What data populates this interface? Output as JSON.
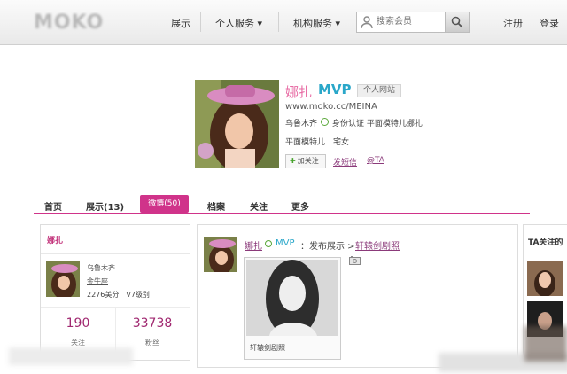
{
  "brand": {
    "logo_text": "MOKO"
  },
  "nav": {
    "items": [
      {
        "label": "展示"
      },
      {
        "label": "个人服务 ▾"
      },
      {
        "label": "机构服务 ▾"
      }
    ],
    "search_placeholder": "搜索会员",
    "register": "注册",
    "login": "登录"
  },
  "profile": {
    "name": "娜扎",
    "badge": "MVP",
    "site_button": "个人网站",
    "url": "www.moko.cc/MEINA",
    "city": "乌鲁木齐",
    "verification": "身份认证 平面模特儿娜扎",
    "tags": "平面模特儿　宅女",
    "follow_button": "加关注",
    "message_link": "发短信",
    "at_link": "@TA"
  },
  "tabs": [
    {
      "label": "首页"
    },
    {
      "label": "展示(13)"
    },
    {
      "label": "微博(50)"
    },
    {
      "label": "档案"
    },
    {
      "label": "关注"
    },
    {
      "label": "更多"
    }
  ],
  "left_card": {
    "title": "娜扎",
    "city": "乌鲁木齐",
    "link": "金牛座",
    "score": "2276美分　V7级别",
    "stats": [
      {
        "value": "190",
        "label": "关注"
      },
      {
        "value": "33738",
        "label": "粉丝"
      }
    ]
  },
  "feed": {
    "post": {
      "user": "娜扎",
      "badge": "MVP",
      "action": "：发布展示 >",
      "link": "轩辕剑剧照",
      "caption": "轩辕剑剧照"
    }
  },
  "right_panel": {
    "title": "TA关注的"
  },
  "colors": {
    "accent": "#d0338a",
    "mvp": "#2aa7c9",
    "name": "#e76aa3",
    "link": "#8b3a7a"
  },
  "icons": [
    "user-icon",
    "search-icon",
    "verify-icon",
    "plus-icon",
    "photo-icon"
  ]
}
